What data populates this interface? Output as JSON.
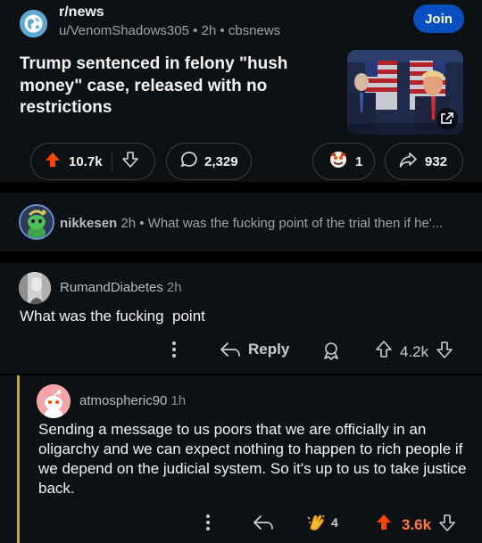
{
  "post": {
    "subreddit": "r/news",
    "meta": "u/VenomShadows305 • 2h • cbsnews",
    "join_label": "Join",
    "title": "Trump sentenced in felony \"hush money\" case, released with no restrictions",
    "upvotes": "10.7k",
    "comments": "2,329",
    "awards": "1",
    "shares": "932"
  },
  "collapsed_comment": {
    "username": "nikkesen",
    "time": "2h",
    "preview": "• What was the fucking point of the trial then if he'..."
  },
  "comment1": {
    "username": "RumandDiabetes",
    "time": "2h",
    "body": "What was the fucking  point",
    "reply_label": "Reply",
    "votes": "4.2k"
  },
  "comment2": {
    "username": "atmospheric90",
    "time": "1h",
    "body": "Sending a message to us poors that we are officially in an oligarchy and we can expect nothing to happen to rich people if we depend on the judicial system. So it's up to us to take justice back.",
    "awards": "4",
    "votes": "3.6k"
  },
  "colors": {
    "upvote_orange": "#ff4500",
    "join_blue": "#0a4fbf",
    "thread_gold": "#d4a81a"
  }
}
